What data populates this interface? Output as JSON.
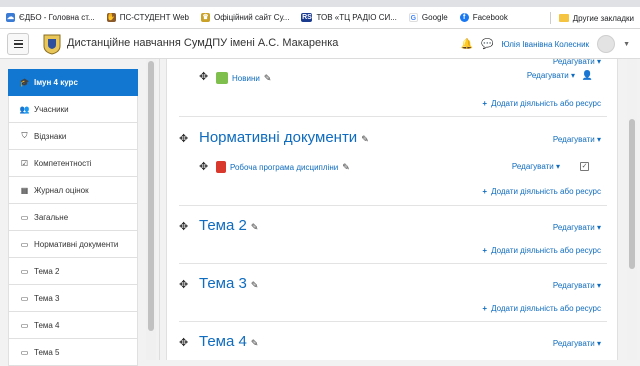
{
  "bookmarks": [
    {
      "label": "ЄДБО - Головна ст...",
      "icon": "cloud-icon",
      "color": "#3a7bd5"
    },
    {
      "label": "ПС-СТУДЕНТ Web",
      "icon": "hand-icon",
      "color": "#8a5a2b"
    },
    {
      "label": "Офіційний сайт Су...",
      "icon": "crest-icon",
      "color": "#c9a227"
    },
    {
      "label": "ТОВ «ТЦ РАДІО СИ...",
      "icon": "rs-logo-icon",
      "color": "#1b3b8f"
    },
    {
      "label": "Google",
      "icon": "google-icon",
      "color": "#4285f4"
    },
    {
      "label": "Facebook",
      "icon": "facebook-icon",
      "color": "#1877f2"
    }
  ],
  "other_bookmarks": "Другие закладки",
  "site": {
    "name": "Дистанційне навчання СумДПУ імені А.С. Макаренка",
    "user": "Юлія Іванівна Колесник"
  },
  "drawer": {
    "items": [
      {
        "label": "Імун 4 курс",
        "icon": "graduation-cap-icon",
        "glyph": "🎓",
        "active": true
      },
      {
        "label": "Учасники",
        "icon": "users-icon",
        "glyph": "👥",
        "active": false
      },
      {
        "label": "Відзнаки",
        "icon": "shield-icon",
        "glyph": "⛉",
        "active": false
      },
      {
        "label": "Компетентності",
        "icon": "checkbox-icon",
        "glyph": "☑",
        "active": false
      },
      {
        "label": "Журнал оцінок",
        "icon": "table-icon",
        "glyph": "▦",
        "active": false
      },
      {
        "label": "Загальне",
        "icon": "folder-icon",
        "glyph": "▭",
        "active": false
      },
      {
        "label": "Нормативні документи",
        "icon": "folder-icon",
        "glyph": "▭",
        "active": false
      },
      {
        "label": "Тема 2",
        "icon": "folder-icon",
        "glyph": "▭",
        "active": false
      },
      {
        "label": "Тема 3",
        "icon": "folder-icon",
        "glyph": "▭",
        "active": false
      },
      {
        "label": "Тема 4",
        "icon": "folder-icon",
        "glyph": "▭",
        "active": false
      },
      {
        "label": "Тема 5",
        "icon": "folder-icon",
        "glyph": "▭",
        "active": false
      }
    ]
  },
  "main": {
    "edit_label": "Редагувати",
    "add_label": "Додати діяльність або ресурс",
    "news_activity": "Новини",
    "sections": [
      {
        "title": "Нормативні документи",
        "activity": "Робоча програма дисципліни"
      },
      {
        "title": "Тема 2"
      },
      {
        "title": "Тема 3"
      },
      {
        "title": "Тема 4"
      }
    ]
  }
}
